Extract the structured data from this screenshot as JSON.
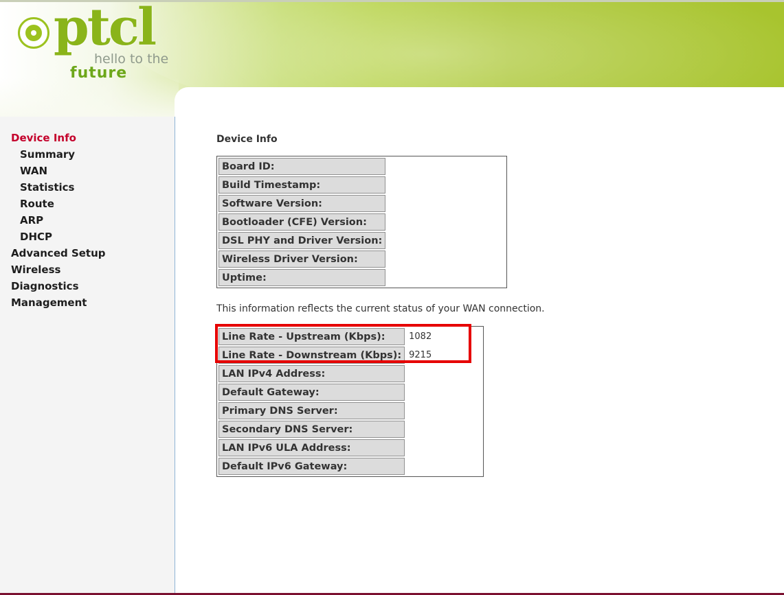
{
  "brand": {
    "logo_text": "ptcl",
    "tagline_1": "hello to the",
    "tagline_2": "future"
  },
  "sidebar": {
    "items": [
      {
        "label": "Device Info",
        "active": true,
        "level": 0
      },
      {
        "label": "Summary",
        "level": 1
      },
      {
        "label": "WAN",
        "level": 1
      },
      {
        "label": "Statistics",
        "level": 1
      },
      {
        "label": "Route",
        "level": 1
      },
      {
        "label": "ARP",
        "level": 1
      },
      {
        "label": "DHCP",
        "level": 1
      },
      {
        "label": "Advanced Setup",
        "level": 0
      },
      {
        "label": "Wireless",
        "level": 0
      },
      {
        "label": "Diagnostics",
        "level": 0
      },
      {
        "label": "Management",
        "level": 0
      }
    ]
  },
  "main": {
    "title": "Device Info",
    "device_table": [
      {
        "label": "Board ID:",
        "value": ""
      },
      {
        "label": "Build Timestamp:",
        "value": ""
      },
      {
        "label": "Software Version:",
        "value": ""
      },
      {
        "label": "Bootloader (CFE) Version:",
        "value": ""
      },
      {
        "label": "DSL PHY and Driver Version:",
        "value": ""
      },
      {
        "label": "Wireless Driver Version:",
        "value": ""
      },
      {
        "label": "Uptime:",
        "value": ""
      }
    ],
    "note": "This information reflects the current status of your WAN connection.",
    "wan_table": [
      {
        "label": "Line Rate - Upstream (Kbps):",
        "value": "1082"
      },
      {
        "label": "Line Rate - Downstream (Kbps):",
        "value": "9215"
      },
      {
        "label": "LAN IPv4 Address:",
        "value": ""
      },
      {
        "label": "Default Gateway:",
        "value": ""
      },
      {
        "label": "Primary DNS Server:",
        "value": ""
      },
      {
        "label": "Secondary DNS Server:",
        "value": ""
      },
      {
        "label": "LAN IPv6 ULA Address:",
        "value": ""
      },
      {
        "label": "Default IPv6 Gateway:",
        "value": ""
      }
    ]
  },
  "colors": {
    "active_nav": "#c4002b",
    "highlight_box": "#e60000",
    "brand_green": "#8ab41a"
  }
}
